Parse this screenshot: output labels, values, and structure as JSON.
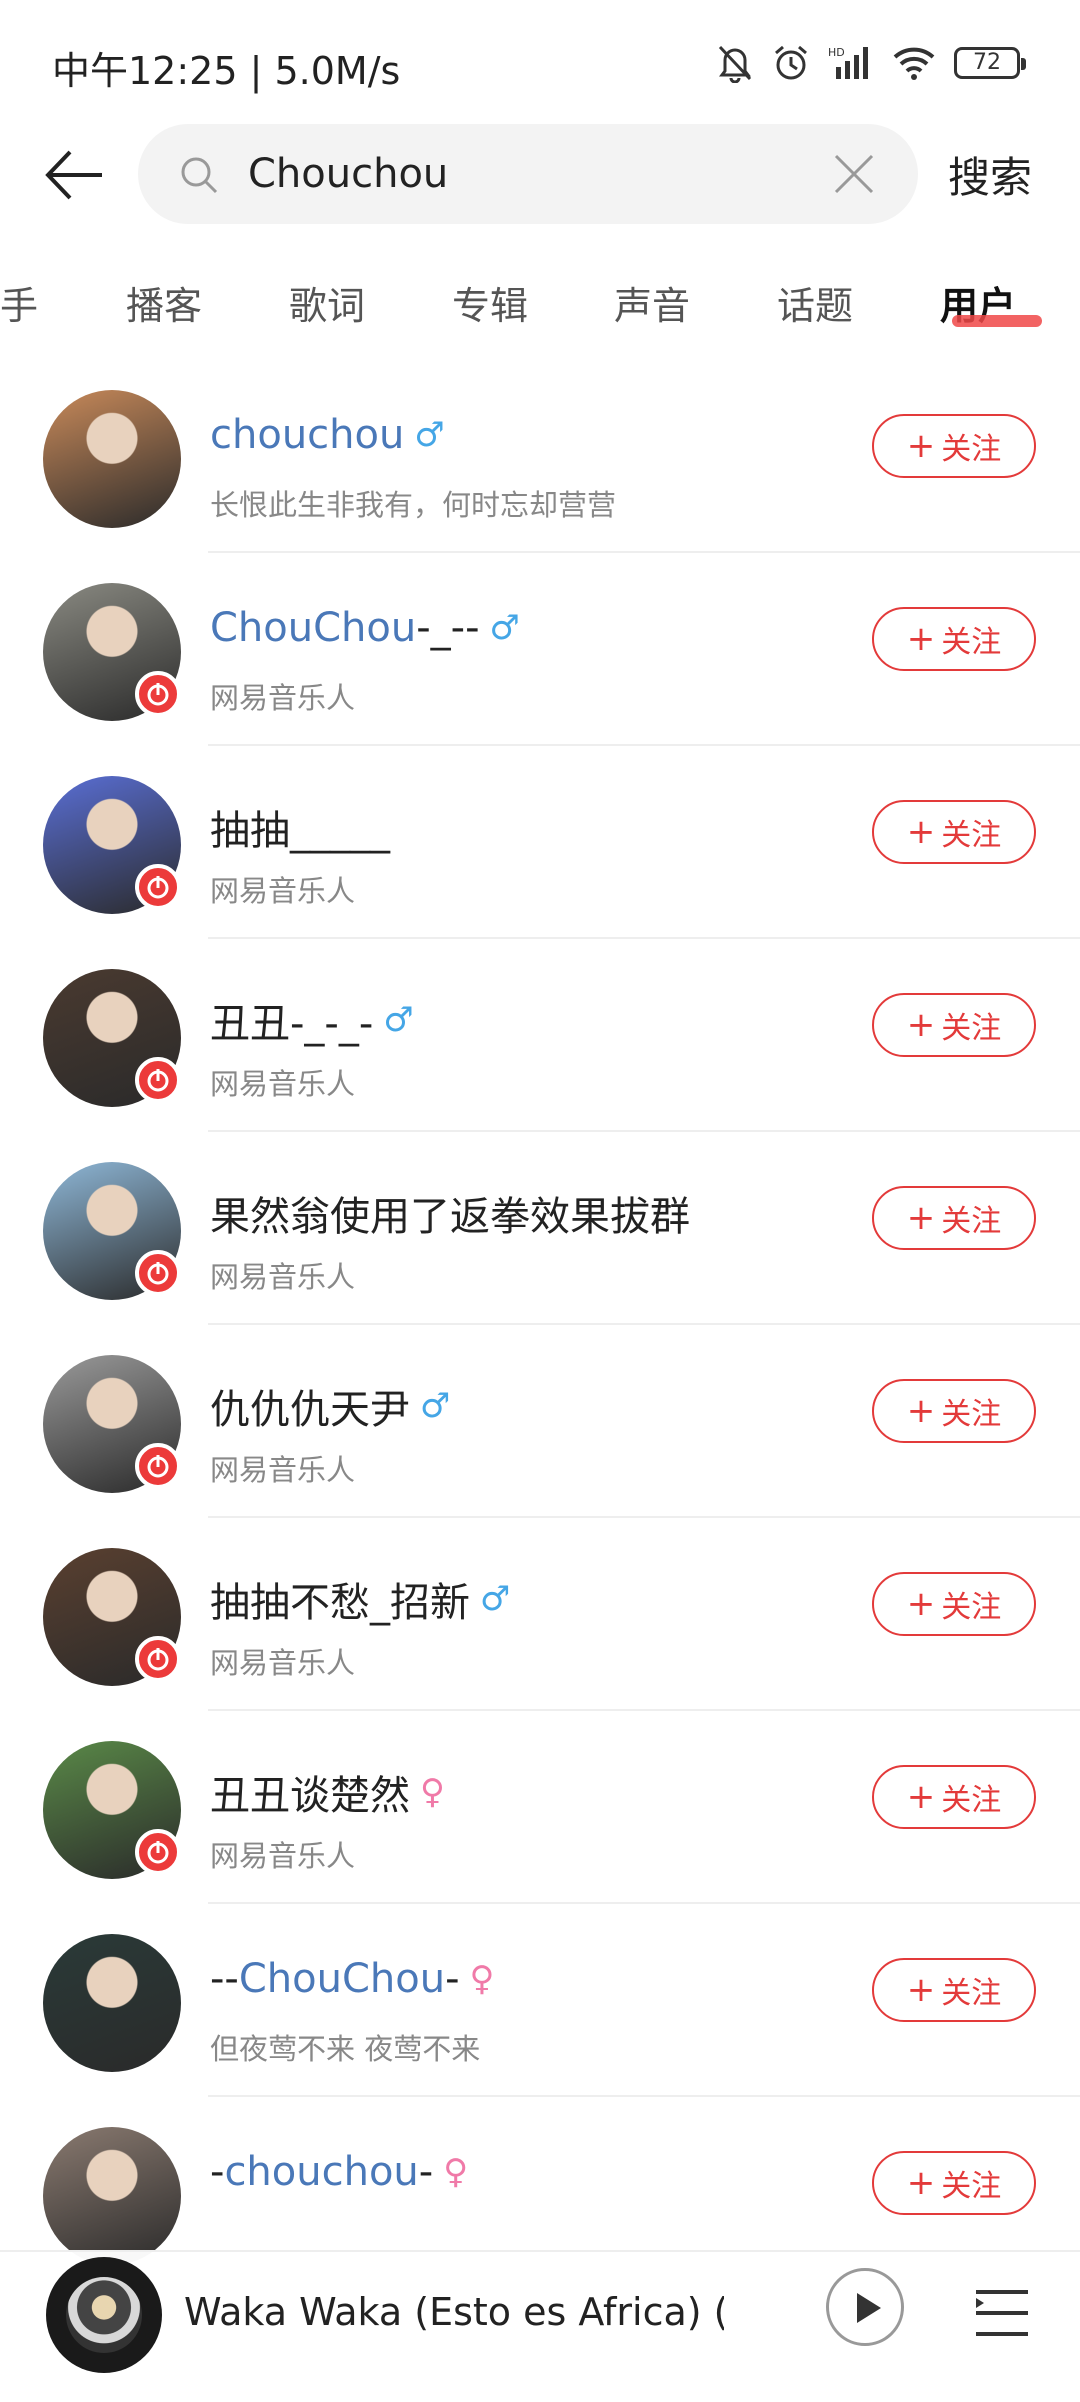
{
  "status_bar": {
    "time": "中午12:25 | 5.0M/s",
    "battery": "72"
  },
  "search": {
    "query": "Chouchou",
    "submit_label": "搜索"
  },
  "tabs": [
    {
      "label": "手",
      "active": false
    },
    {
      "label": "播客",
      "active": false
    },
    {
      "label": "歌词",
      "active": false
    },
    {
      "label": "专辑",
      "active": false
    },
    {
      "label": "声音",
      "active": false
    },
    {
      "label": "话题",
      "active": false
    },
    {
      "label": "用户",
      "active": true
    }
  ],
  "users": [
    {
      "name_pre": "",
      "name_hl": "chouchou",
      "name_post": "",
      "gender": "male",
      "sub": "长恨此生非我有，何时忘却营营",
      "verified": false,
      "avatar_color": "#c98a5a"
    },
    {
      "name_pre": "",
      "name_hl": "ChouChou",
      "name_post": "-_--",
      "gender": "male",
      "sub": "网易音乐人",
      "verified": true,
      "avatar_color": "#8a8a82"
    },
    {
      "name_pre": "抽抽_____",
      "name_hl": "",
      "name_post": "",
      "gender": "",
      "sub": "网易音乐人",
      "verified": true,
      "avatar_color": "#5a6fd6"
    },
    {
      "name_pre": "丑丑-_-_-",
      "name_hl": "",
      "name_post": "",
      "gender": "male",
      "sub": "网易音乐人",
      "verified": true,
      "avatar_color": "#4a3a30"
    },
    {
      "name_pre": "果然翁使用了返拳效果拔群",
      "name_hl": "",
      "name_post": "",
      "gender": "",
      "sub": "网易音乐人",
      "verified": true,
      "avatar_color": "#8fb8d8"
    },
    {
      "name_pre": "仇仇仇天尹",
      "name_hl": "",
      "name_post": "",
      "gender": "male",
      "sub": "网易音乐人",
      "verified": true,
      "avatar_color": "#9a9a9a"
    },
    {
      "name_pre": "抽抽不愁_招新",
      "name_hl": "",
      "name_post": "",
      "gender": "male",
      "sub": "网易音乐人",
      "verified": true,
      "avatar_color": "#5a4030"
    },
    {
      "name_pre": "丑丑谈楚然",
      "name_hl": "",
      "name_post": "",
      "gender": "female",
      "sub": "网易音乐人",
      "verified": true,
      "avatar_color": "#5a8a48"
    },
    {
      "name_pre": "--",
      "name_hl": "ChouChou",
      "name_post": "-",
      "gender": "female",
      "sub": "但夜莺不来 夜莺不来",
      "verified": false,
      "avatar_color": "#2a3a38"
    },
    {
      "name_pre": "-",
      "name_hl": "chouchou",
      "name_post": "-",
      "gender": "female",
      "sub": "",
      "verified": false,
      "avatar_color": "#8a7a70"
    }
  ],
  "follow_label": "关注",
  "gender_symbols": {
    "male": "♂",
    "female": "♀"
  },
  "player": {
    "song_title": "Waka Waka (Esto es Africa) (..."
  },
  "colors": {
    "accent": "#e33a3a",
    "highlight": "#4a78b8",
    "male": "#45a6e6",
    "female": "#f07aa8"
  }
}
